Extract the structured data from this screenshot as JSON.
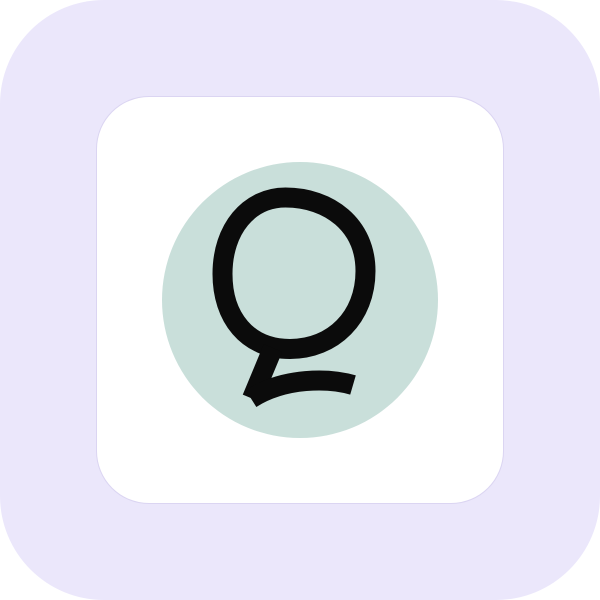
{
  "app_icon": {
    "name": "q-logo-icon",
    "colors": {
      "outer_background": "#ebe7fb",
      "card_background": "#ffffff",
      "circle_fill": "#c9dfda",
      "glyph_stroke": "#0b0b0b"
    }
  }
}
